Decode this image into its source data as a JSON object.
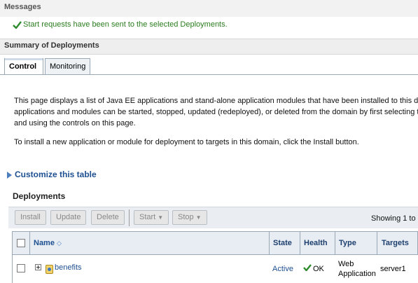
{
  "messages": {
    "title": "Messages",
    "success": "Start requests have been sent to the selected Deployments."
  },
  "summary": {
    "title": "Summary of Deployments",
    "tabs": [
      {
        "label": "Control",
        "active": true
      },
      {
        "label": "Monitoring",
        "active": false
      }
    ]
  },
  "intro": {
    "line1": "This page displays a list of Java EE applications and stand-alone application modules that have been installed to this dom",
    "line2": "applications and modules can be started, stopped, updated (redeployed), or deleted from the domain by first selecting t",
    "line3": "and using the controls on this page.",
    "install_note": "To install a new application or module for deployment to targets in this domain, click the Install button."
  },
  "customize_link": "Customize this table",
  "deployments": {
    "title": "Deployments",
    "toolbar": {
      "install": "Install",
      "update": "Update",
      "delete": "Delete",
      "start": "Start",
      "stop": "Stop",
      "showing": "Showing 1 to"
    },
    "columns": [
      "Name",
      "State",
      "Health",
      "Type",
      "Targets"
    ],
    "rows": [
      {
        "name": "benefits",
        "state": "Active",
        "health": "OK",
        "type_line1": "Web",
        "type_line2": "Application",
        "targets": "server1"
      }
    ]
  },
  "colors": {
    "success_text": "#2b7d1f",
    "link": "#1d4f91",
    "header_bg": "#e8edf3"
  }
}
